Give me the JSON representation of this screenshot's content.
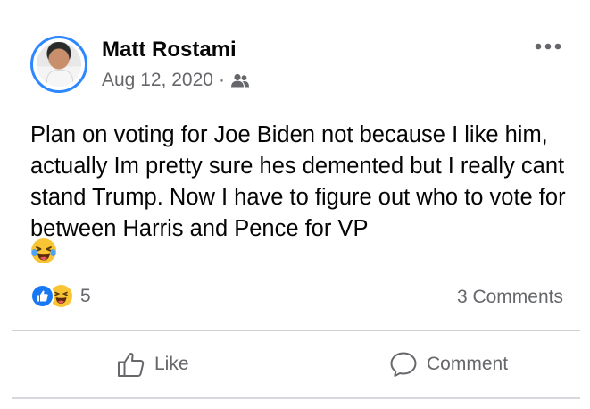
{
  "post": {
    "author": "Matt Rostami",
    "date": "Aug 12, 2020",
    "separator": "·",
    "audience_icon": "friends-icon",
    "text": "Plan on voting for Joe Biden not because I like him, actually Im pretty sure hes demented but I really cant stand Trump. Now I have to figure out who to vote for between Harris and Pence for VP",
    "trailing_emoji": "laughing-crying-emoji"
  },
  "stats": {
    "reaction_icons": [
      "like-reaction-icon",
      "haha-reaction-icon"
    ],
    "reaction_count": "5",
    "comments": "3 Comments"
  },
  "actions": {
    "like_label": "Like",
    "comment_label": "Comment"
  },
  "colors": {
    "like_blue": "#1877f2",
    "avatar_ring": "#2d88ff",
    "secondary_text": "#65676b"
  }
}
